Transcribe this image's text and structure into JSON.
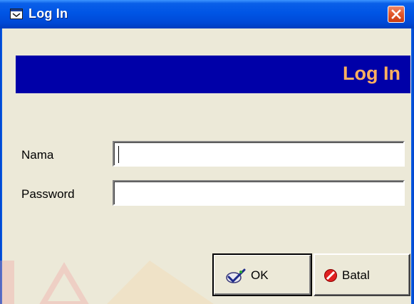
{
  "window": {
    "title": "Log In",
    "icon": "window-app-icon"
  },
  "banner": {
    "text": "Log In",
    "bg_color": "#0000a8",
    "text_color": "#ffb060"
  },
  "form": {
    "nama_label": "Nama",
    "nama_value": "",
    "password_label": "Password",
    "password_value": ""
  },
  "buttons": {
    "ok_label": "OK",
    "ok_icon": "ok-check-icon",
    "batal_label": "Batal",
    "batal_icon": "cancel-icon"
  },
  "colors": {
    "titlebar": "#0055e5",
    "close": "#e3592d",
    "window_bg": "#ece9d8"
  }
}
